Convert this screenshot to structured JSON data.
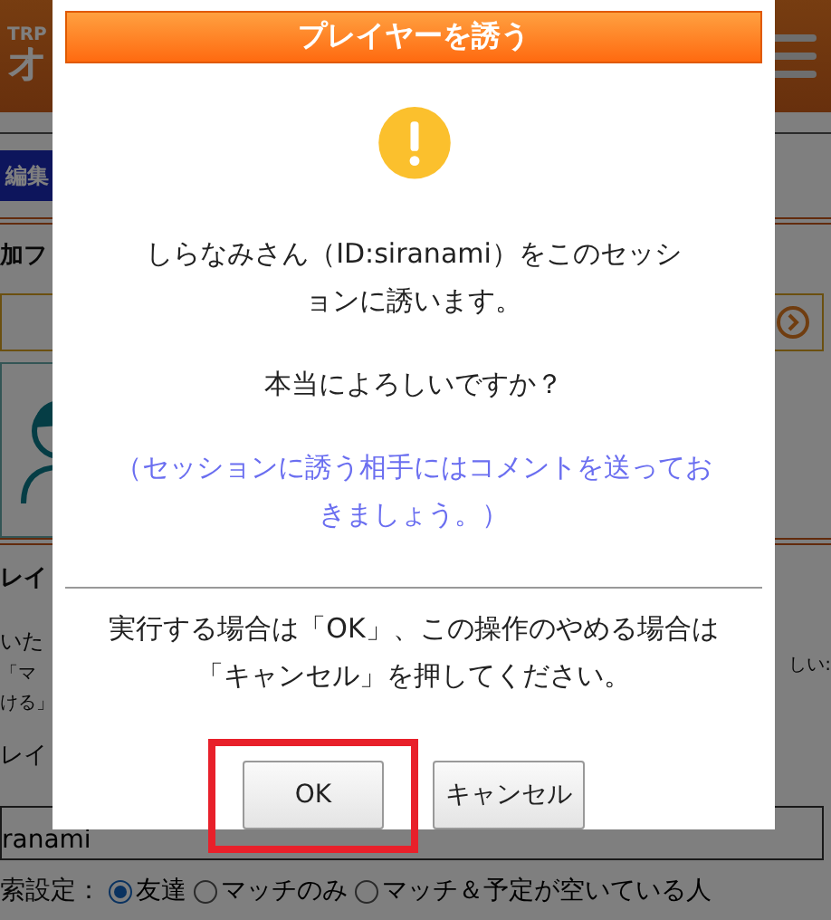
{
  "background": {
    "logo": {
      "text": "TRP",
      "mark": "オ"
    },
    "edit_button": "編集",
    "section_1_heading": "加フ",
    "section_2_heading": "レイ",
    "section_2_lines": [
      "いた",
      "「マ",
      "ける」"
    ],
    "right_note": "しい:",
    "field_label": "レイ",
    "field_value": "ranami",
    "search_settings": {
      "label": "索設定：",
      "options": [
        {
          "label": "友達",
          "selected": true
        },
        {
          "label": "マッチのみ",
          "selected": false
        },
        {
          "label": "マッチ＆予定が空いている人",
          "selected": false
        }
      ]
    }
  },
  "dialog": {
    "title": "プレイヤーを誘う",
    "message": "しらなみさん（ID:siranami）をこのセッションに誘います。",
    "question": "本当によろしいですか？",
    "note": "（セッションに誘う相手にはコメントを送っておきましょう。）",
    "instruction": "実行する場合は「OK」、この操作のやめる場合は「キャンセル」を押してください。",
    "buttons": [
      {
        "label": "OK",
        "highlighted": true
      },
      {
        "label": "キャンセル",
        "highlighted": false
      }
    ]
  }
}
